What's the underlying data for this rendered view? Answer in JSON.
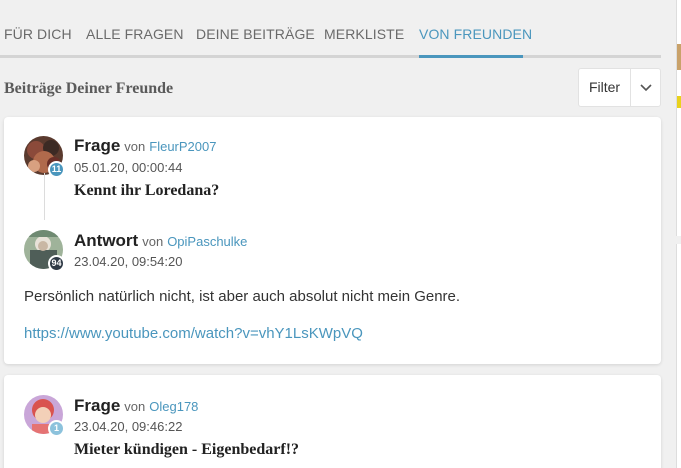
{
  "tabs": [
    {
      "label": "FÜR DICH",
      "active": false
    },
    {
      "label": "ALLE FRAGEN",
      "active": false
    },
    {
      "label": "DEINE BEITRÄGE",
      "active": false
    },
    {
      "label": "MERKLISTE",
      "active": false
    },
    {
      "label": "VON FREUNDEN",
      "active": true
    }
  ],
  "section_title": "Beiträge Deiner Freunde",
  "filter": {
    "label": "Filter",
    "icon": "chevron-down-icon"
  },
  "feed": [
    {
      "question": {
        "kind": "Frage",
        "von": "von",
        "user": "FleurP2007",
        "badge": "11",
        "timestamp": "05.01.20, 00:00:44",
        "title": "Kennt ihr Loredana?"
      },
      "answer": {
        "kind": "Antwort",
        "von": "von",
        "user": "OpiPaschulke",
        "badge": "94",
        "timestamp": "23.04.20, 09:54:20",
        "text": "Persönlich natürlich nicht, ist aber auch absolut nicht mein Genre.",
        "link": "https://www.youtube.com/watch?v=vhY1LsKWpVQ"
      }
    },
    {
      "question": {
        "kind": "Frage",
        "von": "von",
        "user": "Oleg178",
        "badge": "1",
        "timestamp": "23.04.20, 09:46:22",
        "title": "Mieter kündigen - Eigenbedarf!?"
      }
    }
  ],
  "colors": {
    "accent": "#4a96bd",
    "background": "#f0f0f0",
    "card": "#ffffff"
  }
}
